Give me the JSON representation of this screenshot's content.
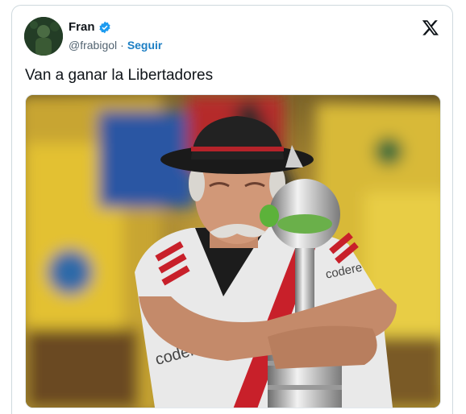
{
  "tweet": {
    "author_name": "Fran",
    "handle": "@frabigol",
    "separator": "·",
    "follow_label": "Seguir",
    "text": "Van a ganar la Libertadores",
    "verified": true
  },
  "media": {
    "jersey_sponsor": "codere",
    "description_icon": "photo"
  },
  "colors": {
    "accent": "#1d9bf0",
    "follow": "#1d7fc4",
    "text": "#0f1419",
    "muted": "#536471"
  }
}
